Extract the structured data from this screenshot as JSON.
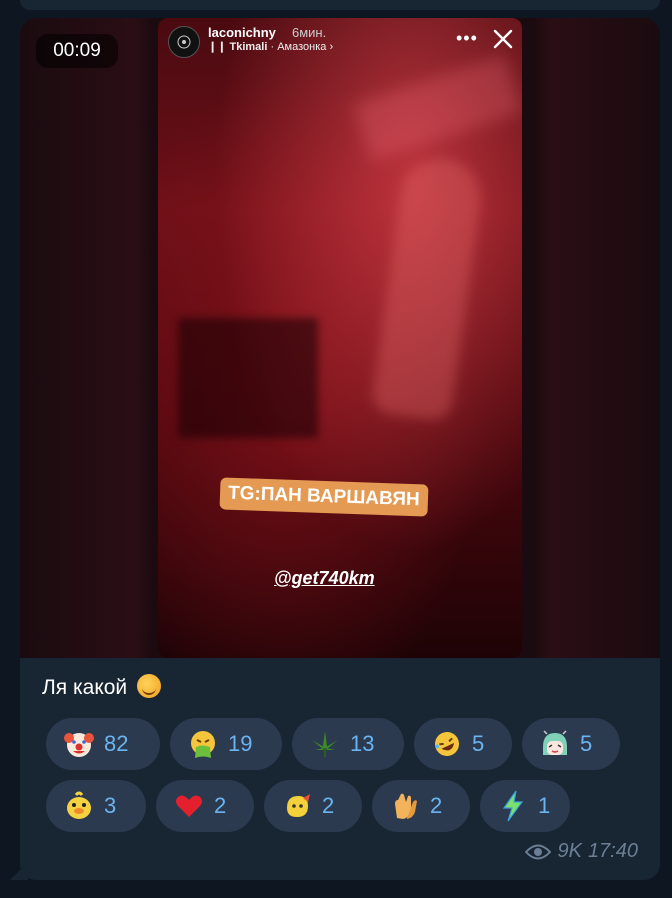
{
  "media": {
    "duration": "00:09",
    "story": {
      "username": "laconichny",
      "time_ago": "6мин.",
      "music_artist": "Tkimali",
      "music_track": "Амазонка",
      "more_glyph": "•••",
      "sticker_text": "TG:ПАН ВАРШАВЯН",
      "mention_text": "@get740km"
    }
  },
  "message": {
    "caption": "Ля какой"
  },
  "reactions": [
    {
      "icon": "clown-face-icon",
      "count": "82"
    },
    {
      "icon": "vomiting-face-icon",
      "count": "19"
    },
    {
      "icon": "cannabis-leaf-icon",
      "count": "13"
    },
    {
      "icon": "rolling-laughing-face-icon",
      "count": "5"
    },
    {
      "icon": "anime-girl-sticker-icon",
      "count": "5"
    },
    {
      "icon": "duck-sticker-icon",
      "count": "3"
    },
    {
      "icon": "red-heart-icon",
      "count": "2"
    },
    {
      "icon": "yellow-blob-sticker-icon",
      "count": "2"
    },
    {
      "icon": "clapping-hands-icon",
      "count": "2"
    },
    {
      "icon": "lightning-icon",
      "count": "1"
    }
  ],
  "footer": {
    "views": "9K",
    "time": "17:40"
  },
  "colors": {
    "background": "#0e1621",
    "bubble": "#182533",
    "reaction_bg": "#2b3a4e",
    "reaction_text": "#6bb4f2",
    "meta_text": "#6b7f95"
  }
}
